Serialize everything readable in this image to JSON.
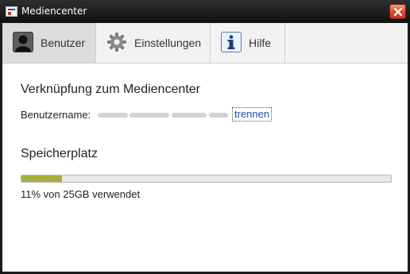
{
  "window": {
    "title": "Mediencenter"
  },
  "tabs": [
    {
      "label": "Benutzer",
      "icon": "user-silhouette-icon",
      "active": true
    },
    {
      "label": "Einstellungen",
      "icon": "gear-icon",
      "active": false
    },
    {
      "label": "Hilfe",
      "icon": "info-icon",
      "active": false
    }
  ],
  "account": {
    "heading": "Verknüpfung zum Mediencenter",
    "username_label": "Benutzername:",
    "username_value": "",
    "disconnect_link": "trennen"
  },
  "storage": {
    "heading": "Speicherplatz",
    "used_fraction": 0.11,
    "usage_text": "11% von 25GB verwendet"
  },
  "colors": {
    "titlebar": "#1b1b1b",
    "close_button": "#d94b28",
    "progress_fill": "#a5b03c",
    "link": "#1e4fa3"
  }
}
